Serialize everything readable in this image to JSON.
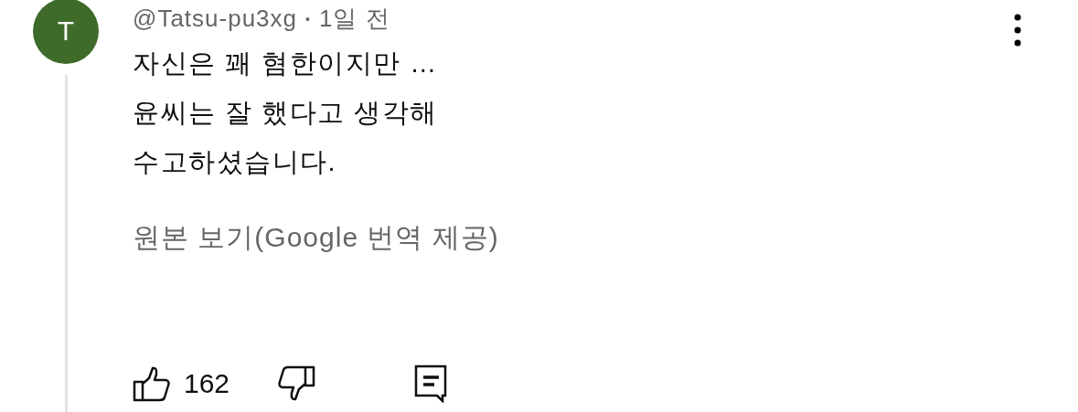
{
  "comment": {
    "avatar_letter": "T",
    "author": "@Tatsu-pu3xg",
    "separator": "•",
    "time": "1일 전",
    "lines": [
      "자신은 꽤 혐한이지만 …",
      "윤씨는 잘 했다고 생각해",
      "수고하셨습니다."
    ],
    "translation_link": "원본 보기(Google 번역 제공)",
    "like_count": "162"
  }
}
